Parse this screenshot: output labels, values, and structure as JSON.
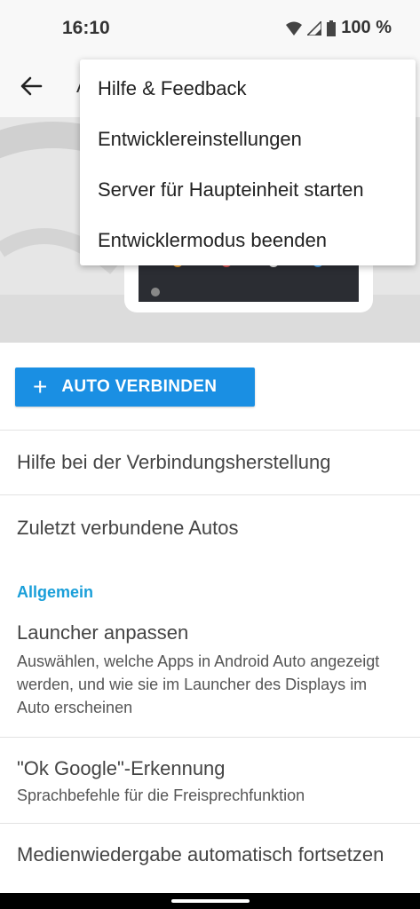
{
  "status": {
    "time": "16:10",
    "battery": "100 %"
  },
  "appbar": {
    "title": "Android Auto"
  },
  "overflow_menu": {
    "items": [
      {
        "label": "Hilfe & Feedback"
      },
      {
        "label": "Entwicklereinstellungen"
      },
      {
        "label": "Server für Haupteinheit starten"
      },
      {
        "label": "Entwicklermodus beenden"
      }
    ]
  },
  "main": {
    "connect_button": {
      "icon": "+",
      "label": "AUTO VERBINDEN"
    },
    "help_row": "Hilfe bei der Verbindungsherstellung",
    "recent_row": "Zuletzt verbundene Autos",
    "section_general": "Allgemein",
    "launcher": {
      "title": "Launcher anpassen",
      "subtitle": "Auswählen, welche Apps in Android Auto angezeigt werden, und wie sie im Launcher des Displays im Auto erscheinen"
    },
    "ok_google": {
      "title": "\"Ok Google\"-Erkennung",
      "subtitle": "Sprachbefehle für die Freisprechfunktion"
    },
    "media_resume": {
      "title": "Medienwiedergabe automatisch fortsetzen"
    }
  },
  "colors": {
    "accent": "#1a8fe3",
    "section": "#1a9fd9"
  }
}
